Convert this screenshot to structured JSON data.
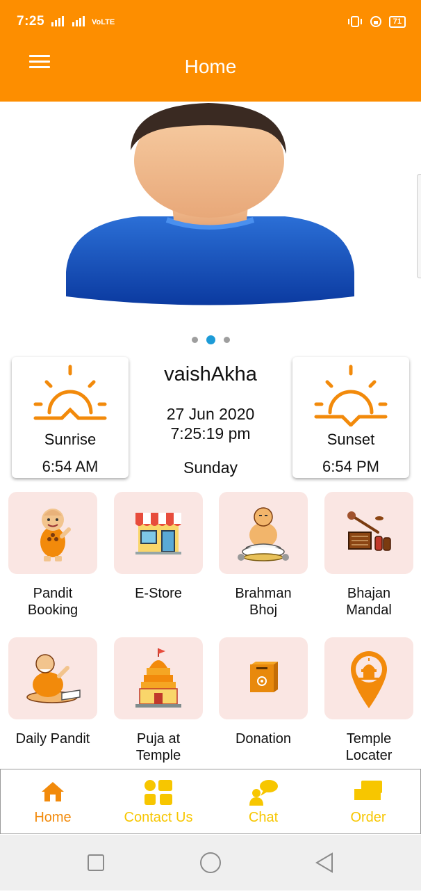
{
  "status_bar": {
    "time": "7:25",
    "network": "VoLTE",
    "battery": "71"
  },
  "appbar": {
    "title": "Home"
  },
  "carousel": {
    "slide_count": 3,
    "active_index": 1
  },
  "sunrise": {
    "label": "Sunrise",
    "time": "6:54 AM"
  },
  "sunset": {
    "label": "Sunset",
    "time": "6:54 PM"
  },
  "panchang": {
    "month": "vaishAkha",
    "date": "27 Jun 2020",
    "time": "7:25:19 pm",
    "day": "Sunday"
  },
  "services": [
    {
      "label": "Pandit\nBooking",
      "icon": "pandit-icon"
    },
    {
      "label": "E-Store",
      "icon": "store-icon"
    },
    {
      "label": "Brahman\nBhoj",
      "icon": "brahman-bhoj-icon"
    },
    {
      "label": "Bhajan\nMandal",
      "icon": "instruments-icon"
    },
    {
      "label": "Daily Pandit",
      "icon": "daily-pandit-icon"
    },
    {
      "label": "Puja at\nTemple",
      "icon": "temple-icon"
    },
    {
      "label": "Donation",
      "icon": "donation-box-icon"
    },
    {
      "label": "Temple\nLocater",
      "icon": "location-pin-icon"
    }
  ],
  "bottom_nav": [
    {
      "label": "Home",
      "icon": "home-icon",
      "active": true
    },
    {
      "label": "Contact Us",
      "icon": "contact-icon",
      "active": false
    },
    {
      "label": "Chat",
      "icon": "chat-icon",
      "active": false
    },
    {
      "label": "Order",
      "icon": "order-icon",
      "active": false
    }
  ],
  "colors": {
    "primary": "#fd8e00",
    "nav_active": "#f28a0b",
    "nav_inactive": "#f7c600",
    "tile_bg": "#fae6e3",
    "dot_active": "#1d9bd7"
  }
}
